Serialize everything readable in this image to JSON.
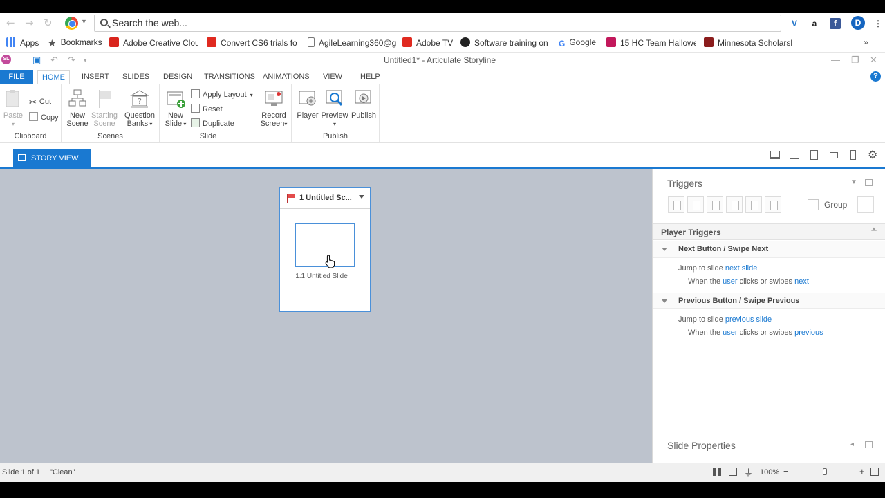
{
  "browser": {
    "omnibox_placeholder": "Search the web...",
    "bookmarks": [
      {
        "label": "Apps",
        "icon": "apps-grid-icon",
        "color": "#4285f4"
      },
      {
        "label": "Bookmarks",
        "icon": "star-icon",
        "color": "#555555"
      },
      {
        "label": "Adobe Creative Clou",
        "icon": "adobe-cc-icon",
        "color": "#d9251d"
      },
      {
        "label": "Convert CS6 trials for",
        "icon": "adobe-icon",
        "color": "#e02a20"
      },
      {
        "label": "AgileLearning360@g",
        "icon": "document-icon",
        "color": "#777777"
      },
      {
        "label": "Adobe TV",
        "icon": "adobe-icon",
        "color": "#e02a20"
      },
      {
        "label": "Software training on",
        "icon": "lynda-icon",
        "color": "#222222"
      },
      {
        "label": "Google",
        "icon": "google-icon",
        "color": "#4285f4"
      },
      {
        "label": "15 HC Team Hallowe",
        "icon": "hc-icon",
        "color": "#c2185b"
      },
      {
        "label": "Minnesota Scholarsh",
        "icon": "minnesota-icon",
        "color": "#8b1d1d"
      }
    ]
  },
  "app": {
    "window_title": "Untitled1* -  Articulate Storyline",
    "badge": "SL"
  },
  "ribbon": {
    "tabs": [
      "FILE",
      "HOME",
      "INSERT",
      "SLIDES",
      "DESIGN",
      "TRANSITIONS",
      "ANIMATIONS",
      "VIEW",
      "HELP"
    ],
    "active_tab": "HOME",
    "clipboard": {
      "paste": "Paste",
      "cut": "Cut",
      "copy": "Copy",
      "label": "Clipboard"
    },
    "scenes": {
      "new_scene_1": "New",
      "new_scene_2": "Scene",
      "starting_scene_1": "Starting",
      "starting_scene_2": "Scene",
      "question_banks_1": "Question",
      "question_banks_2": "Banks",
      "label": "Scenes"
    },
    "slide": {
      "new_slide_1": "New",
      "new_slide_2": "Slide",
      "apply_layout": "Apply Layout",
      "reset": "Reset",
      "duplicate": "Duplicate",
      "label": "Slide"
    },
    "record": {
      "line1": "Record",
      "line2": "Screen"
    },
    "publish": {
      "player": "Player",
      "preview": "Preview",
      "publish": "Publish",
      "label": "Publish"
    }
  },
  "view": {
    "story_view_tab": "STORY VIEW"
  },
  "canvas": {
    "scene_title": "1 Untitled Sc...",
    "slide_label": "1.1 Untitled Slide"
  },
  "triggers": {
    "title": "Triggers",
    "group_label": "Group",
    "player_triggers_header": "Player Triggers",
    "next": {
      "header": "Next Button / Swipe Next",
      "action_prefix": "Jump to slide ",
      "action_link": "next slide",
      "cond_prefix": "When the ",
      "cond_user": "user",
      "cond_mid": " clicks or swipes ",
      "cond_link": "next"
    },
    "previous": {
      "header": "Previous Button / Swipe Previous",
      "action_prefix": "Jump to slide ",
      "action_link": "previous slide",
      "cond_prefix": "When the ",
      "cond_user": "user",
      "cond_mid": " clicks or swipes ",
      "cond_link": "previous"
    },
    "slide_properties": "Slide Properties"
  },
  "status": {
    "slide_count": "Slide 1 of 1",
    "theme": "\"Clean\"",
    "zoom": "100%",
    "zoom_fraction": 0.5
  },
  "colors": {
    "accent": "#1a79d1",
    "canvas_bg": "#bdc3cd"
  }
}
